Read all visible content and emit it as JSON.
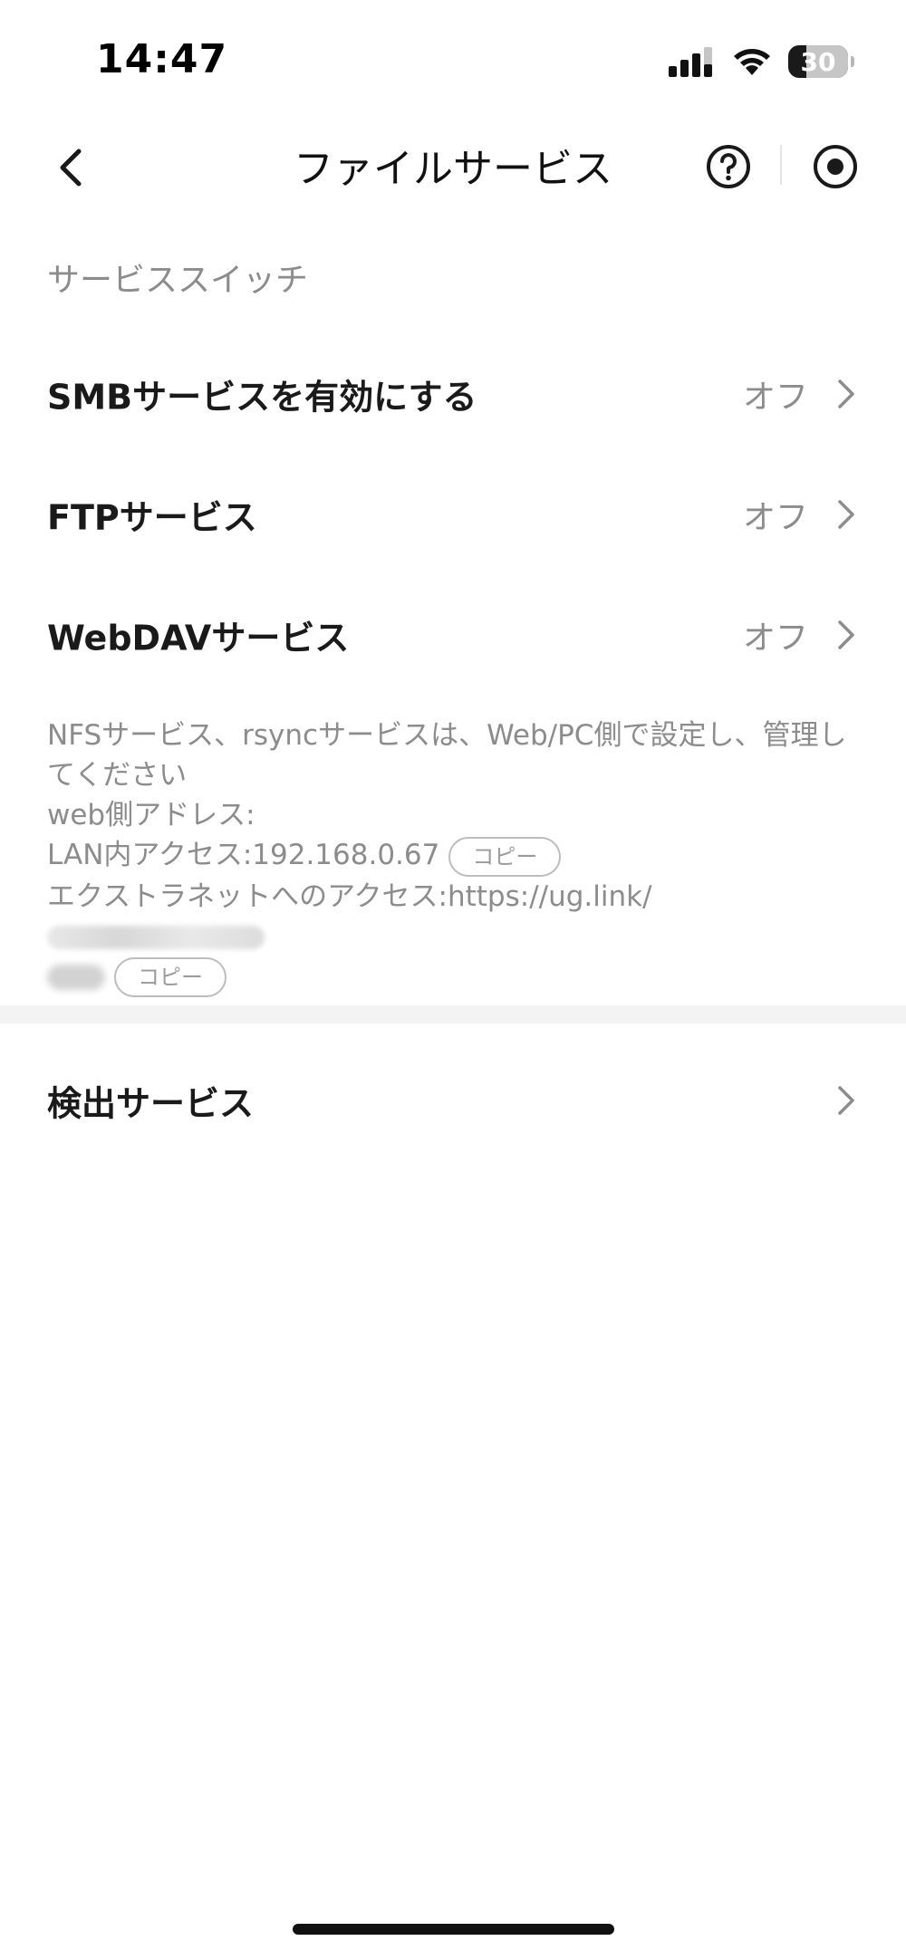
{
  "status_bar": {
    "time": "14:47",
    "battery_level": "30"
  },
  "nav": {
    "title": "ファイルサービス",
    "back_icon": "chevron-left-icon",
    "help_icon": "question-circle-icon",
    "record_icon": "record-icon"
  },
  "section_switch": {
    "header": "サービススイッチ",
    "rows": [
      {
        "label": "SMBサービスを有効にする",
        "value": "オフ"
      },
      {
        "label": "FTPサービス",
        "value": "オフ"
      },
      {
        "label": "WebDAVサービス",
        "value": "オフ"
      }
    ]
  },
  "info": {
    "note": "NFSサービス、rsyncサービスは、Web/PC側で設定し、管理してください",
    "web_address_label": "web側アドレス:",
    "lan_access": "LAN内アクセス:192.168.0.67",
    "extranet_access": "エクストラネットへのアクセス:https://ug.link/",
    "copy_label": "コピー"
  },
  "discovery": {
    "label": "検出サービス"
  },
  "colors": {
    "text_primary": "#1a1a1a",
    "text_secondary": "#8c8c8c",
    "separator": "#f3f3f3"
  }
}
